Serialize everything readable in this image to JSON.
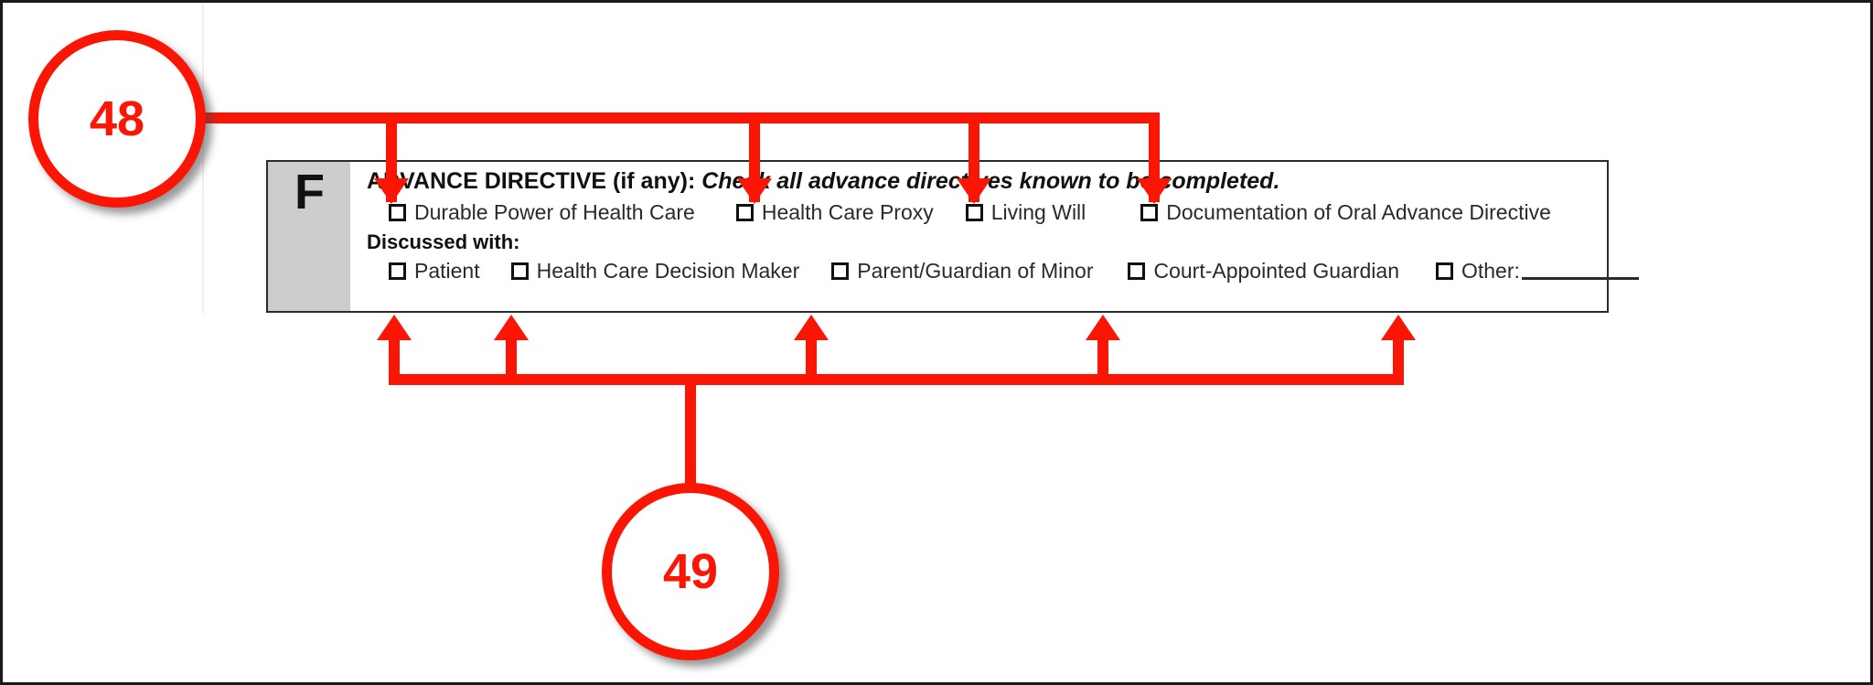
{
  "document": {
    "section_letter": "F",
    "heading_bold": "ADVANCE DIRECTIVE (if any):",
    "heading_italic": "Check all advance directives known to be completed.",
    "directives": [
      {
        "label": "Durable Power of Health Care",
        "checked": false
      },
      {
        "label": "Health Care Proxy",
        "checked": false
      },
      {
        "label": "Living Will",
        "checked": false
      },
      {
        "label": "Documentation of Oral Advance Directive",
        "checked": false
      }
    ],
    "discussed_with_label": "Discussed with:",
    "discussed_with": [
      {
        "label": "Patient",
        "checked": false
      },
      {
        "label": "Health Care Decision Maker",
        "checked": false
      },
      {
        "label": "Parent/Guardian of Minor",
        "checked": false
      },
      {
        "label": "Court-Appointed Guardian",
        "checked": false
      },
      {
        "label": "Other:",
        "checked": false,
        "has_blank_rule": true
      }
    ]
  },
  "annotations": {
    "accent_color": "#fa1505",
    "callouts": [
      {
        "id": "48",
        "number": "48",
        "targets": "advance-directive-checkboxes"
      },
      {
        "id": "49",
        "number": "49",
        "targets": "discussed-with-checkboxes"
      }
    ]
  }
}
